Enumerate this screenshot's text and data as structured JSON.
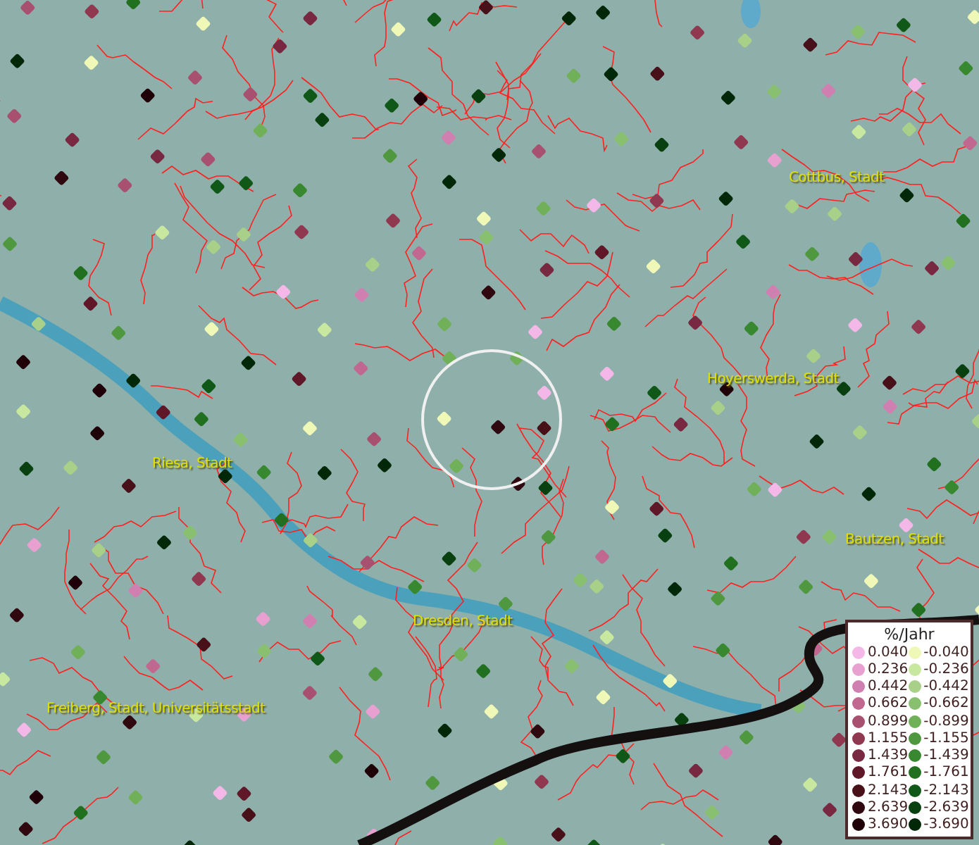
{
  "map": {
    "place_labels": [
      {
        "text": "Cottbus, Stadt"
      },
      {
        "text": "Hoyerswerda, Stadt"
      },
      {
        "text": "Riesa, Stadt"
      },
      {
        "text": "Bautzen, Stadt"
      },
      {
        "text": "Dresden, Stadt"
      },
      {
        "text": "Freiberg, Stadt, Universitätsstadt"
      }
    ]
  },
  "legend": {
    "title": "%/Jahr",
    "rows": [
      {
        "positive": {
          "label": "0.040",
          "color": "#f4b8e8"
        },
        "negative": {
          "label": "-0.040",
          "color": "#f0f8b8"
        }
      },
      {
        "positive": {
          "label": "0.236",
          "color": "#e8a0d0"
        },
        "negative": {
          "label": "-0.236",
          "color": "#c8e8a0"
        }
      },
      {
        "positive": {
          "label": "0.442",
          "color": "#d080b0"
        },
        "negative": {
          "label": "-0.442",
          "color": "#a8d088"
        }
      },
      {
        "positive": {
          "label": "0.662",
          "color": "#c06890"
        },
        "negative": {
          "label": "-0.662",
          "color": "#88c070"
        }
      },
      {
        "positive": {
          "label": "0.899",
          "color": "#a85070"
        },
        "negative": {
          "label": "-0.899",
          "color": "#70b058"
        }
      },
      {
        "positive": {
          "label": "1.155",
          "color": "#903850"
        },
        "negative": {
          "label": "-1.155",
          "color": "#509840"
        }
      },
      {
        "positive": {
          "label": "1.439",
          "color": "#782840"
        },
        "negative": {
          "label": "-1.439",
          "color": "#388830"
        }
      },
      {
        "positive": {
          "label": "1.761",
          "color": "#601828"
        },
        "negative": {
          "label": "-1.761",
          "color": "#207020"
        }
      },
      {
        "positive": {
          "label": "2.143",
          "color": "#481018"
        },
        "negative": {
          "label": "-2.143",
          "color": "#105818"
        }
      },
      {
        "positive": {
          "label": "2.639",
          "color": "#300810"
        },
        "negative": {
          "label": "-2.639",
          "color": "#084010"
        }
      },
      {
        "positive": {
          "label": "3.690",
          "color": "#200008"
        },
        "negative": {
          "label": "-3.690",
          "color": "#002808"
        }
      }
    ]
  }
}
